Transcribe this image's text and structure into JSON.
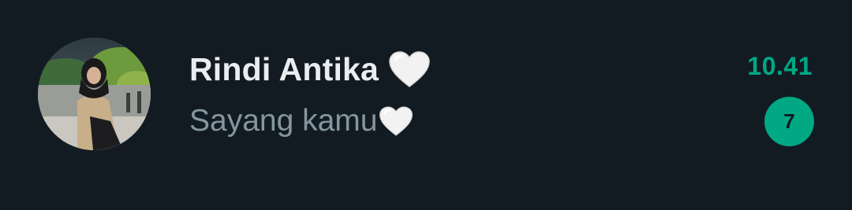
{
  "chat": {
    "contact_name": "Rindi Antika",
    "name_emoji": "white-heart-icon",
    "last_message": "Sayang kamu",
    "message_emoji": "white-heart-icon",
    "time": "10.41",
    "unread_count": "7"
  },
  "colors": {
    "background": "#121B22",
    "name": "#E9EDEF",
    "message": "#8696A0",
    "accent": "#00A884"
  }
}
